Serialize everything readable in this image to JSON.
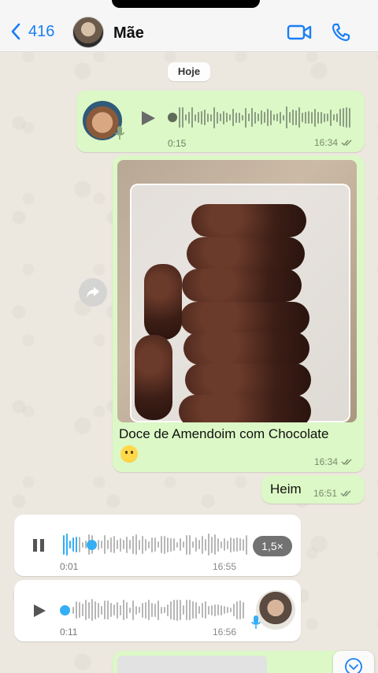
{
  "header": {
    "back_count": "416",
    "contact_name": "Mãe"
  },
  "date_chip": "Hoje",
  "messages": {
    "voice_out": {
      "duration": "0:15",
      "time": "16:34"
    },
    "photo_out": {
      "caption": "Doce de Amendoim com Chocolate",
      "time": "16:34"
    },
    "text_out": {
      "text": "Heim",
      "time": "16:51"
    },
    "voice_in_1": {
      "elapsed": "0:01",
      "time": "16:55",
      "speed": "1,5×",
      "progress": 0.08
    },
    "voice_in_2": {
      "duration": "0:11",
      "time": "16:56"
    }
  },
  "colors": {
    "accent": "#1a7ef5",
    "outgoing_bubble": "#dcf8c6",
    "incoming_bubble": "#ffffff",
    "progress": "#34aef5"
  },
  "icons": [
    "chevron-left-icon",
    "video-icon",
    "phone-icon",
    "play-icon",
    "pause-icon",
    "mic-icon",
    "double-check-icon",
    "forward-icon",
    "chevron-down-icon"
  ]
}
